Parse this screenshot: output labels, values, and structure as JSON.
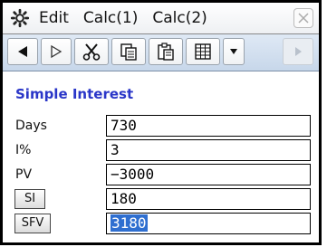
{
  "menubar": {
    "icon": "gear-icon",
    "items": [
      "Edit",
      "Calc(1)",
      "Calc(2)"
    ]
  },
  "toolbar": {
    "icons": [
      "left-arrow-icon",
      "right-arrow-icon",
      "cut-icon",
      "copy-icon",
      "paste-icon",
      "table-icon",
      "dropdown-icon",
      "scroll-right-icon"
    ]
  },
  "section": {
    "title": "Simple Interest"
  },
  "fields": [
    {
      "label": "Days",
      "value": "730"
    },
    {
      "label": "I%",
      "value": "3"
    },
    {
      "label": "PV",
      "value": "−3000"
    }
  ],
  "results": [
    {
      "button": "SI",
      "value": "180"
    },
    {
      "button": "SFV",
      "value": "3180"
    }
  ],
  "colors": {
    "accent": "#2a36c8",
    "toolbar": "#c7d7ea",
    "selection": "#2f6fd0"
  }
}
